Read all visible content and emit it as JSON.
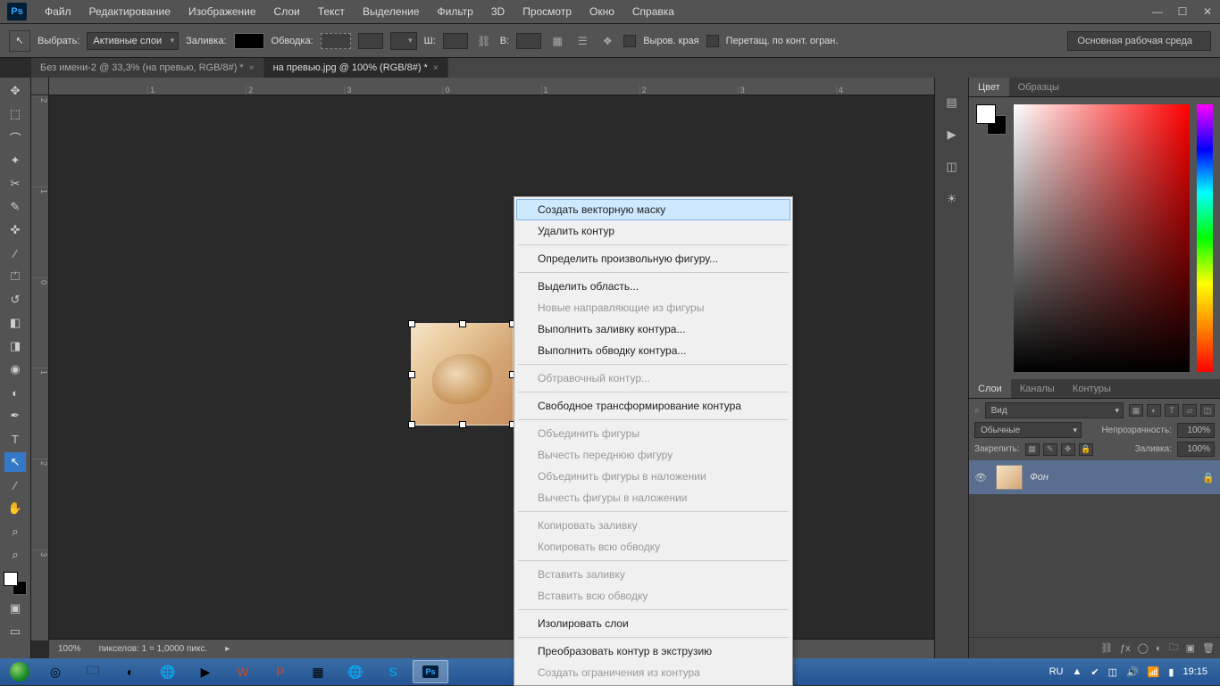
{
  "menubar": {
    "logo": "Ps",
    "items": [
      "Файл",
      "Редактирование",
      "Изображение",
      "Слои",
      "Текст",
      "Выделение",
      "Фильтр",
      "3D",
      "Просмотр",
      "Окно",
      "Справка"
    ]
  },
  "optionsbar": {
    "select_label": "Выбрать:",
    "select_value": "Активные слои",
    "fill_label": "Заливка:",
    "stroke_label": "Обводка:",
    "w_label": "Ш:",
    "h_label": "В:",
    "align_edges": "Выров. края",
    "drag_constrain": "Перетащ. по конт. огран.",
    "workspace": "Основная рабочая среда"
  },
  "tabs": [
    {
      "title": "Без имени-2 @ 33,3% (на превью, RGB/8#) *",
      "active": false
    },
    {
      "title": "на превью.jpg @ 100% (RGB/8#) *",
      "active": true
    }
  ],
  "ruler_h": [
    "",
    "1",
    "2",
    "3",
    "0",
    "1",
    "2",
    "3",
    "4"
  ],
  "ruler_v": [
    "2",
    "1",
    "0",
    "1",
    "2",
    "3"
  ],
  "statusbar": {
    "zoom": "100%",
    "doc_info": "пикселов: 1 = 1,0000 пикс."
  },
  "context_menu": [
    {
      "label": "Создать векторную маску",
      "type": "item",
      "highlight": true
    },
    {
      "label": "Удалить контур",
      "type": "item"
    },
    {
      "type": "sep"
    },
    {
      "label": "Определить произвольную фигуру...",
      "type": "item"
    },
    {
      "type": "sep"
    },
    {
      "label": "Выделить область...",
      "type": "item"
    },
    {
      "label": "Новые направляющие из фигуры",
      "type": "item",
      "disabled": true
    },
    {
      "label": "Выполнить заливку контура...",
      "type": "item"
    },
    {
      "label": "Выполнить обводку контура...",
      "type": "item"
    },
    {
      "type": "sep"
    },
    {
      "label": "Обтравочный контур...",
      "type": "item",
      "disabled": true
    },
    {
      "type": "sep"
    },
    {
      "label": "Свободное трансформирование контура",
      "type": "item"
    },
    {
      "type": "sep"
    },
    {
      "label": "Объединить фигуры",
      "type": "item",
      "disabled": true
    },
    {
      "label": "Вычесть переднюю фигуру",
      "type": "item",
      "disabled": true
    },
    {
      "label": "Объединить фигуры в наложении",
      "type": "item",
      "disabled": true
    },
    {
      "label": "Вычесть фигуры в наложении",
      "type": "item",
      "disabled": true
    },
    {
      "type": "sep"
    },
    {
      "label": "Копировать заливку",
      "type": "item",
      "disabled": true
    },
    {
      "label": "Копировать всю обводку",
      "type": "item",
      "disabled": true
    },
    {
      "type": "sep"
    },
    {
      "label": "Вставить заливку",
      "type": "item",
      "disabled": true
    },
    {
      "label": "Вставить всю обводку",
      "type": "item",
      "disabled": true
    },
    {
      "type": "sep"
    },
    {
      "label": "Изолировать слои",
      "type": "item"
    },
    {
      "type": "sep"
    },
    {
      "label": "Преобразовать контур в экструзию",
      "type": "item"
    },
    {
      "label": "Создать ограничения из контура",
      "type": "item",
      "disabled": true
    }
  ],
  "panels": {
    "color_tabs": [
      "Цвет",
      "Образцы"
    ],
    "layers_tabs": [
      "Слои",
      "Каналы",
      "Контуры"
    ],
    "layers": {
      "kind_label": "Вид",
      "blend_label": "Обычные",
      "opacity_label": "Непрозрачность:",
      "opacity_value": "100%",
      "lock_label": "Закрепить:",
      "fill_label": "Заливка:",
      "fill_value": "100%",
      "layer_name": "Фон"
    }
  },
  "taskbar": {
    "lang": "RU",
    "time": "19:15"
  },
  "tools": [
    "↖",
    "⬚",
    "○",
    "✦",
    "⁄",
    "✎",
    "✜",
    "⌁",
    "⟋",
    "⊥",
    "◆",
    "△",
    "●",
    "⬯",
    "◐",
    "⁄",
    "T",
    "↖",
    "⁄",
    "✋",
    "⌕",
    "⌕"
  ]
}
